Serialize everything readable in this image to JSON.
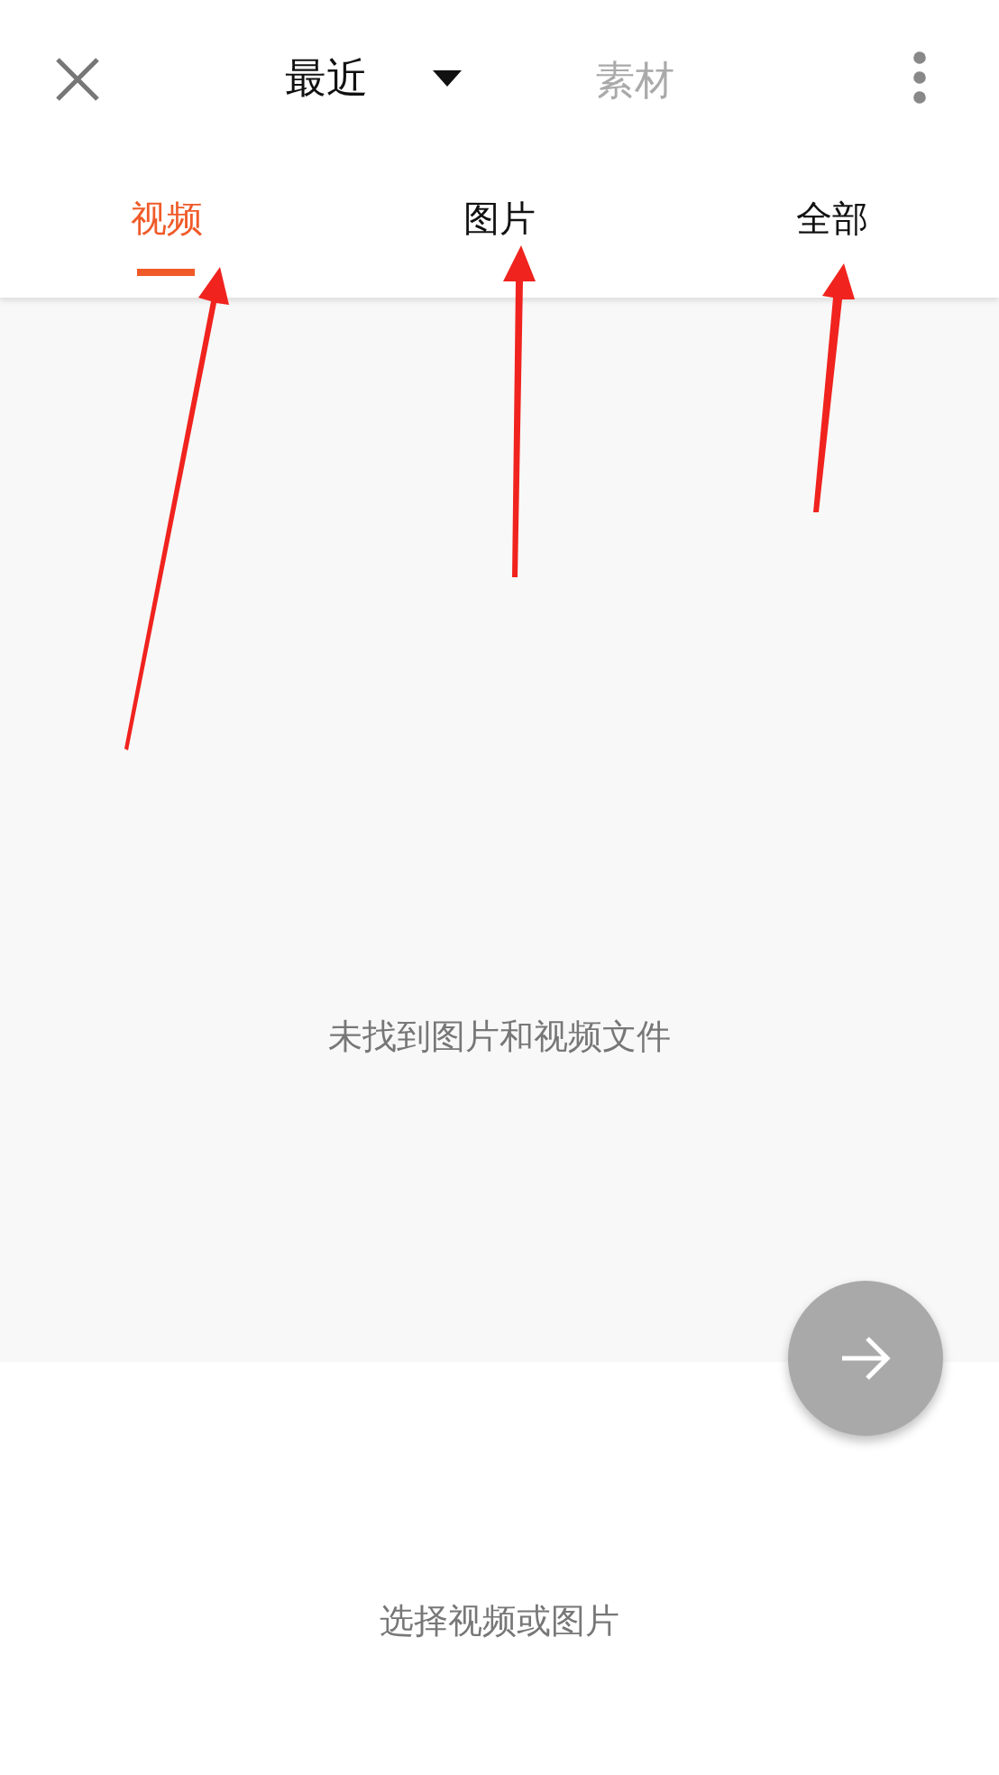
{
  "header": {
    "title": "最近",
    "secondary": "素材"
  },
  "tabs": [
    {
      "label": "视频",
      "selected": true
    },
    {
      "label": "图片",
      "selected": false
    },
    {
      "label": "全部",
      "selected": false
    }
  ],
  "empty_message": "未找到图片和视频文件",
  "footer_hint": "选择视频或图片"
}
